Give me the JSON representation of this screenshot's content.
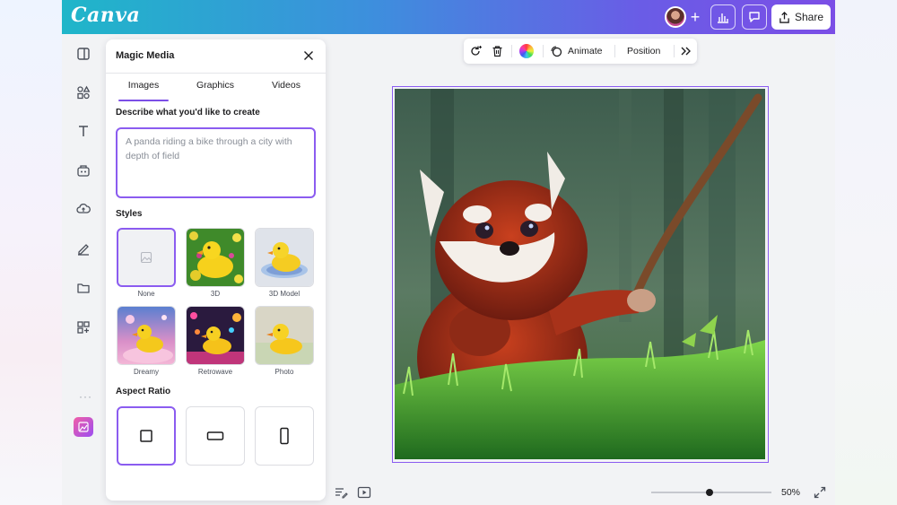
{
  "app": {
    "logo": "Canva"
  },
  "topbar": {
    "add_label": "+",
    "share_label": "Share"
  },
  "panel": {
    "title": "Magic Media",
    "tabs": [
      {
        "label": "Images",
        "active": true
      },
      {
        "label": "Graphics",
        "active": false
      },
      {
        "label": "Videos",
        "active": false
      }
    ],
    "describe_label": "Describe what you'd like to create",
    "prompt_placeholder": "A panda riding a bike through a city with depth of field",
    "styles_label": "Styles",
    "styles": [
      {
        "label": "None",
        "selected": true
      },
      {
        "label": "3D",
        "selected": false
      },
      {
        "label": "3D Model",
        "selected": false
      },
      {
        "label": "Dreamy",
        "selected": false
      },
      {
        "label": "Retrowave",
        "selected": false
      },
      {
        "label": "Photo",
        "selected": false
      }
    ],
    "aspect_label": "Aspect Ratio",
    "aspect_ratios": [
      {
        "shape": "square",
        "selected": true
      },
      {
        "shape": "landscape",
        "selected": false
      },
      {
        "shape": "portrait",
        "selected": false
      }
    ]
  },
  "toolbar": {
    "animate_label": "Animate",
    "position_label": "Position"
  },
  "canvas": {
    "image_subject": "red panda holding a stick in grass"
  },
  "footer": {
    "zoom": "50%",
    "zoom_level": 0.5
  },
  "colors": {
    "accent": "#8b5cf0",
    "topbar_start": "#1fb6c9",
    "topbar_end": "#7b4ee6"
  }
}
